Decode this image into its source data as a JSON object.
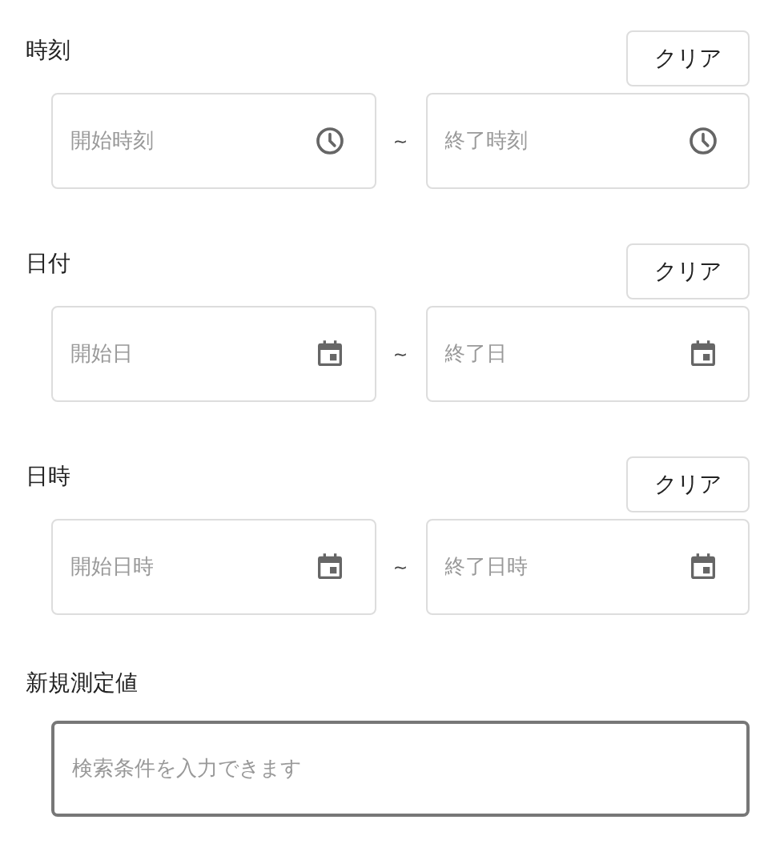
{
  "ranges": [
    {
      "label": "時刻",
      "clear_button": "クリア",
      "kind": "time",
      "start_placeholder": "開始時刻",
      "separator": "~",
      "end_placeholder": "終了時刻"
    },
    {
      "label": "日付",
      "clear_button": "クリア",
      "kind": "date",
      "start_placeholder": "開始日",
      "separator": "~",
      "end_placeholder": "終了日"
    },
    {
      "label": "日時",
      "clear_button": "クリア",
      "kind": "datetime",
      "start_placeholder": "開始日時",
      "separator": "~",
      "end_placeholder": "終了日時"
    }
  ],
  "search": {
    "label": "新規測定値",
    "placeholder": "検索条件を入力できます",
    "focused": true
  }
}
